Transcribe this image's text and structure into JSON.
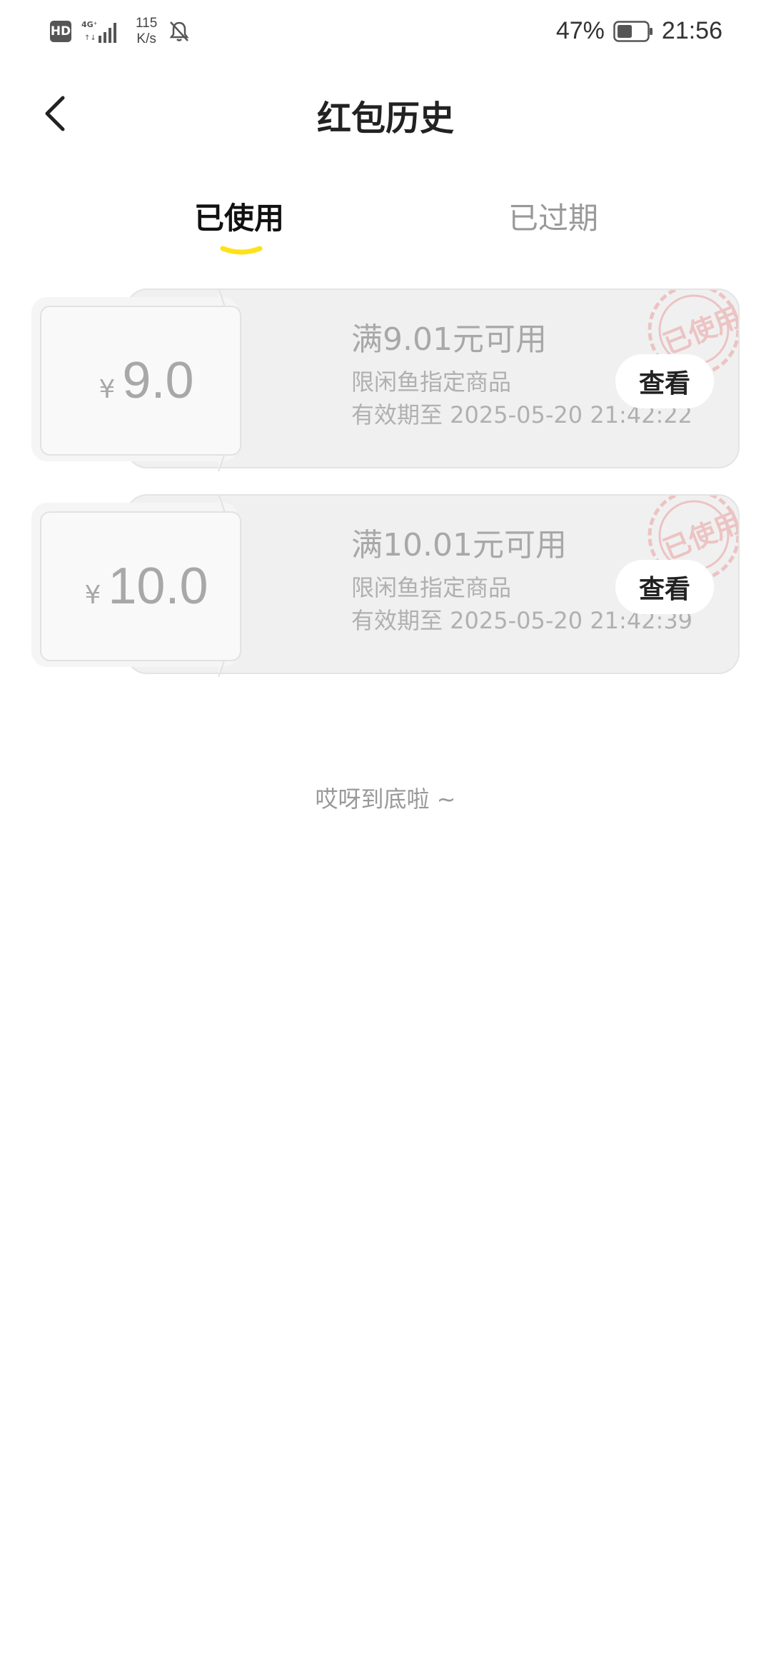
{
  "status_bar": {
    "hd": "HD",
    "network": "4G",
    "speed_value": "115",
    "speed_unit": "K/s",
    "battery_percent": "47%",
    "time": "21:56"
  },
  "nav": {
    "title": "红包历史"
  },
  "tabs": [
    {
      "label": "已使用",
      "active": true
    },
    {
      "label": "已过期",
      "active": false
    }
  ],
  "coupons": [
    {
      "currency": "¥",
      "amount": "9.0",
      "threshold": "满9.01元可用",
      "scope": "限闲鱼指定商品",
      "expiry": "有效期至 2025-05-20 21:42:22",
      "button": "查看",
      "stamp": "已使用"
    },
    {
      "currency": "¥",
      "amount": "10.0",
      "threshold": "满10.01元可用",
      "scope": "限闲鱼指定商品",
      "expiry": "有效期至 2025-05-20 21:42:39",
      "button": "查看",
      "stamp": "已使用"
    }
  ],
  "footer": {
    "end_text": "哎呀到底啦 ~"
  },
  "colors": {
    "accent_yellow": "#ffe11a",
    "card_bg": "#f0f0f0",
    "stamp_red": "#e8a0a0"
  }
}
